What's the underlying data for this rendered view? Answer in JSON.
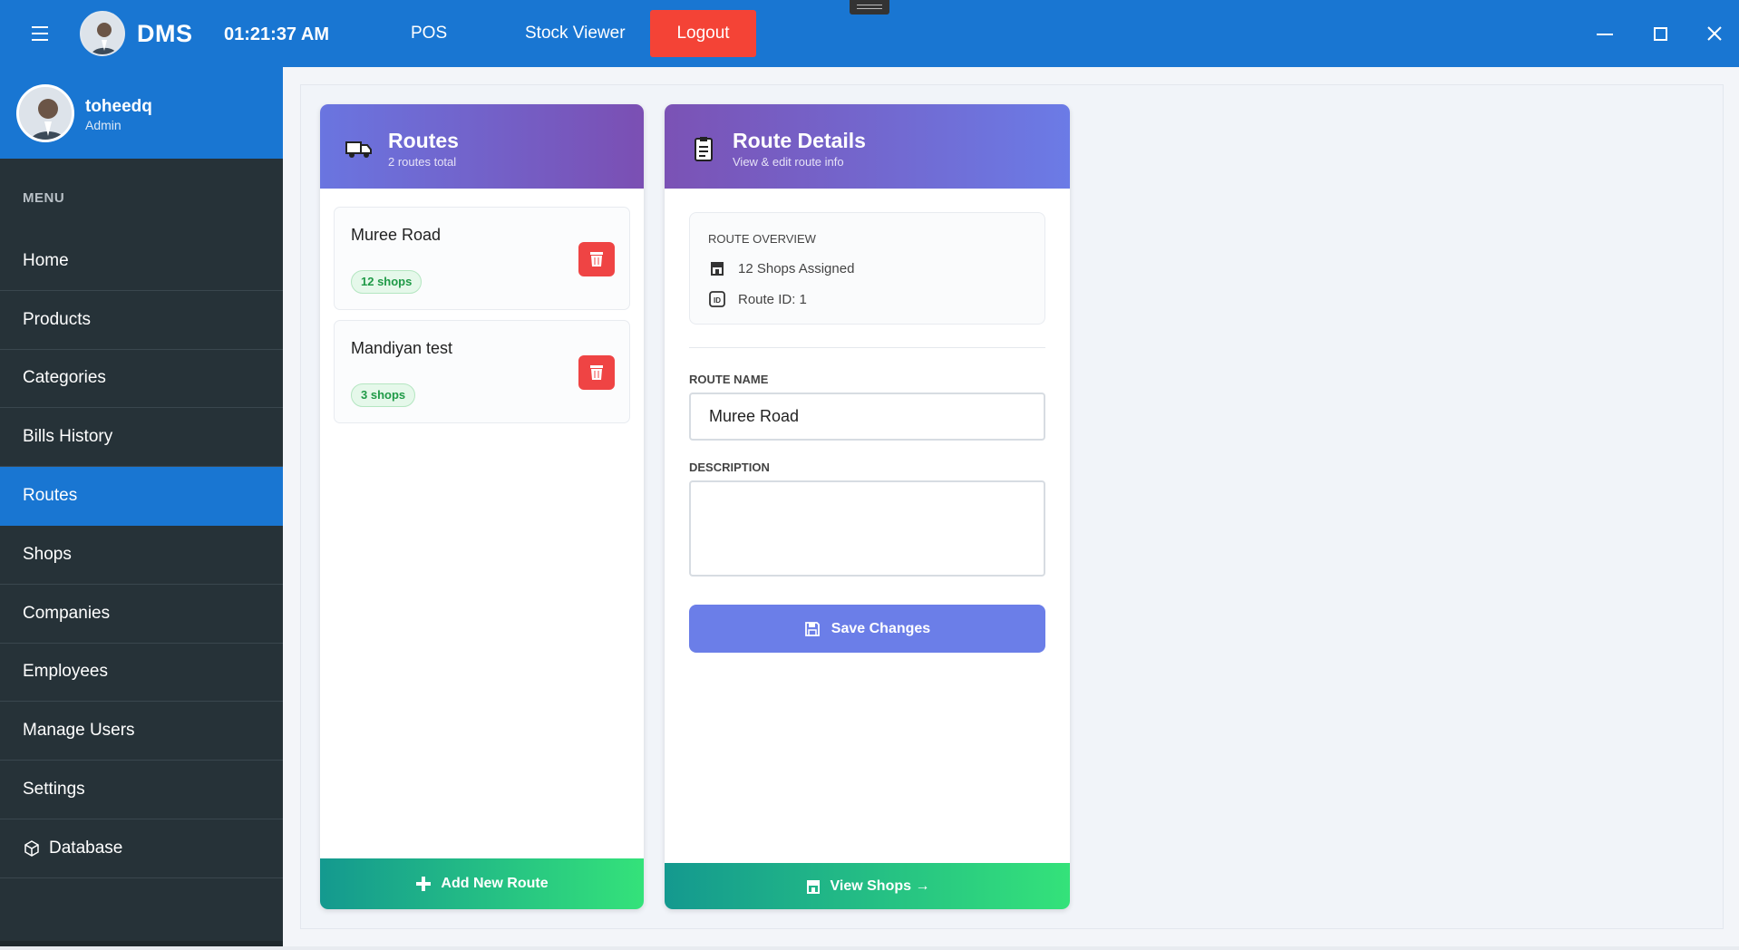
{
  "app": {
    "brand": "DMS",
    "clock": "01:21:37 AM"
  },
  "topnav": {
    "pos": "POS",
    "stock_viewer": "Stock Viewer",
    "logout": "Logout"
  },
  "user": {
    "name": "toheedq",
    "role": "Admin"
  },
  "sidebar": {
    "menu_label": "MENU",
    "items": [
      {
        "label": "Home"
      },
      {
        "label": "Products"
      },
      {
        "label": "Categories"
      },
      {
        "label": "Bills History"
      },
      {
        "label": "Routes"
      },
      {
        "label": "Shops"
      },
      {
        "label": "Companies"
      },
      {
        "label": "Employees"
      },
      {
        "label": "Manage Users"
      },
      {
        "label": "Settings"
      },
      {
        "label": "Database"
      }
    ],
    "active_item": "Routes"
  },
  "routes_panel": {
    "title": "Routes",
    "subtitle": "2 routes total",
    "routes": [
      {
        "name": "Muree Road",
        "shops": "12 shops"
      },
      {
        "name": "Mandiyan test",
        "shops": "3 shops"
      }
    ],
    "add_button": "Add New Route"
  },
  "details_panel": {
    "title": "Route Details",
    "subtitle": "View & edit route info",
    "overview_title": "ROUTE OVERVIEW",
    "shops_assigned": "12 Shops Assigned",
    "route_id": "Route ID: 1",
    "name_label": "ROUTE NAME",
    "name_value": "Muree Road",
    "description_label": "DESCRIPTION",
    "description_value": "",
    "save_button": "Save Changes",
    "view_shops_button": "View Shops →"
  },
  "colors": {
    "topbar": "#1976d2",
    "sidebar": "#263238",
    "logout": "#f44336",
    "delete": "#ef4444",
    "save": "#6b7ee8",
    "badge_green": "#1f9a47"
  }
}
